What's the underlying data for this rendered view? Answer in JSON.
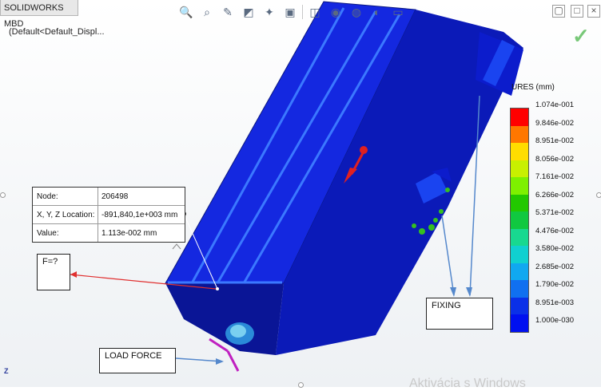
{
  "app": {
    "tab_label": "SOLIDWORKS MBD",
    "config_label": "(Default<Default_Displ..."
  },
  "toolbar": {
    "icons": [
      "zoom-to-fit-icon",
      "zoom-area-icon",
      "previous-view-icon",
      "section-view-icon",
      "view-settings-icon",
      "display-style-icon",
      "view-orientation-icon",
      "hide-show-icon",
      "appearance-icon",
      "scene-icon",
      "display-settings-icon"
    ]
  },
  "window_controls": {
    "restore": "▢",
    "tile": "□",
    "close": "×"
  },
  "probe": {
    "node_label": "Node:",
    "node_value": "206498",
    "xyz_label": "X, Y, Z Location:",
    "xyz_value": "-891,840,1e+003 mm",
    "value_label": "Value:",
    "value_value": "1.113e-002 mm"
  },
  "annotations": {
    "force_question": "F=?",
    "fixing": "FIXING",
    "load_force": "LOAD FORCE"
  },
  "legend": {
    "title": "URES (mm)",
    "labels": [
      "1.074e-001",
      "9.846e-002",
      "8.951e-002",
      "8.056e-002",
      "7.161e-002",
      "6.266e-002",
      "5.371e-002",
      "4.476e-002",
      "3.580e-002",
      "2.685e-002",
      "1.790e-002",
      "8.951e-003",
      "1.000e-030"
    ],
    "colors": [
      "#ff0000",
      "#ff7700",
      "#ffdd00",
      "#c8f000",
      "#7ef000",
      "#22c800",
      "#10c840",
      "#18d890",
      "#10d0d0",
      "#10a8f0",
      "#1070f0",
      "#0a30e8",
      "#0010f0"
    ]
  },
  "colors": {
    "model_body": "#0a1fd8",
    "model_dark": "#091a8c",
    "arrow": "#e02020",
    "leader": "#5588cc"
  },
  "watermark": "Aktivácia s Windows"
}
